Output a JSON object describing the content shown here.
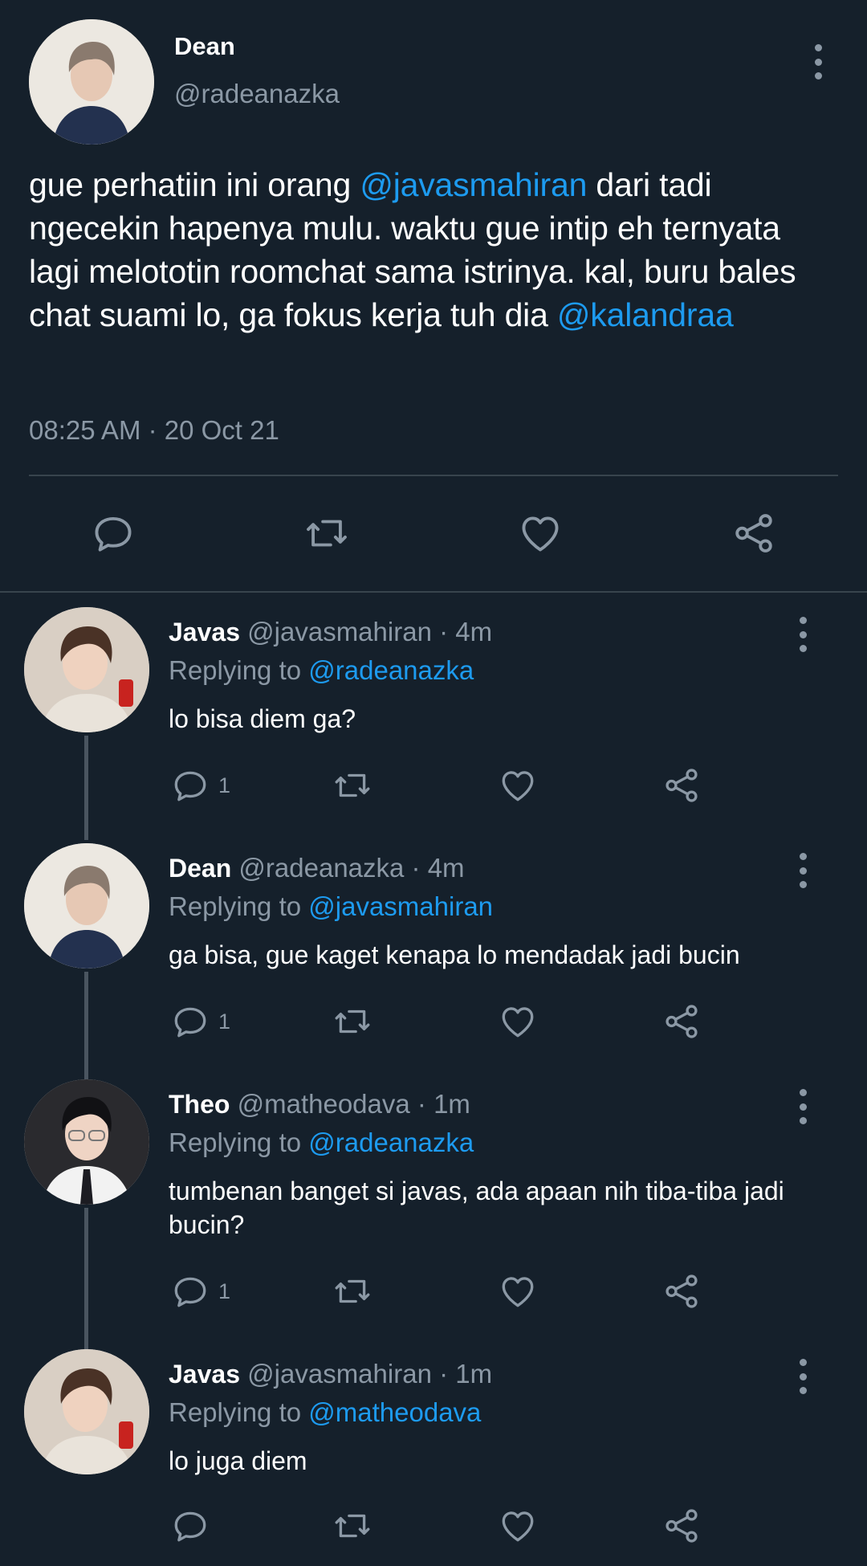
{
  "main_tweet": {
    "name": "Dean",
    "handle": "@radeanazka",
    "text_parts": [
      "gue perhatiin ini orang ",
      "@javasmahiran",
      " dari tadi ngecekin hapenya mulu. waktu gue intip eh ternyata lagi melototin roomchat sama istrinya. kal, buru bales chat suami lo, ga fokus kerja tuh dia ",
      "@kalandraa"
    ],
    "timestamp": "08:25 AM · 20 Oct 21"
  },
  "replies": [
    {
      "name": "Javas",
      "meta": "@javasmahiran · 4m",
      "replying_label": "Replying to ",
      "replying_to": "@radeanazka",
      "text": "lo bisa diem ga?",
      "reply_count": "1"
    },
    {
      "name": "Dean",
      "meta": "@radeanazka · 4m",
      "replying_label": "Replying to ",
      "replying_to": "@javasmahiran",
      "text": "ga bisa, gue kaget kenapa lo mendadak jadi bucin",
      "reply_count": "1"
    },
    {
      "name": "Theo",
      "meta": "@matheodava · 1m",
      "replying_label": "Replying to ",
      "replying_to": "@radeanazka",
      "text": "tumbenan banget si javas, ada apaan nih tiba-tiba jadi bucin?",
      "reply_count": "1"
    },
    {
      "name": "Javas",
      "meta": "@javasmahiran · 1m",
      "replying_label": "Replying to ",
      "replying_to": "@matheodava",
      "text": "lo juga diem",
      "reply_count": ""
    }
  ],
  "colors": {
    "background": "#15202b",
    "accent": "#1d9bf0",
    "secondary_text": "#8b98a5",
    "divider": "#38444d"
  },
  "icons": [
    "reply-icon",
    "retweet-icon",
    "like-icon",
    "share-icon",
    "more-icon"
  ]
}
